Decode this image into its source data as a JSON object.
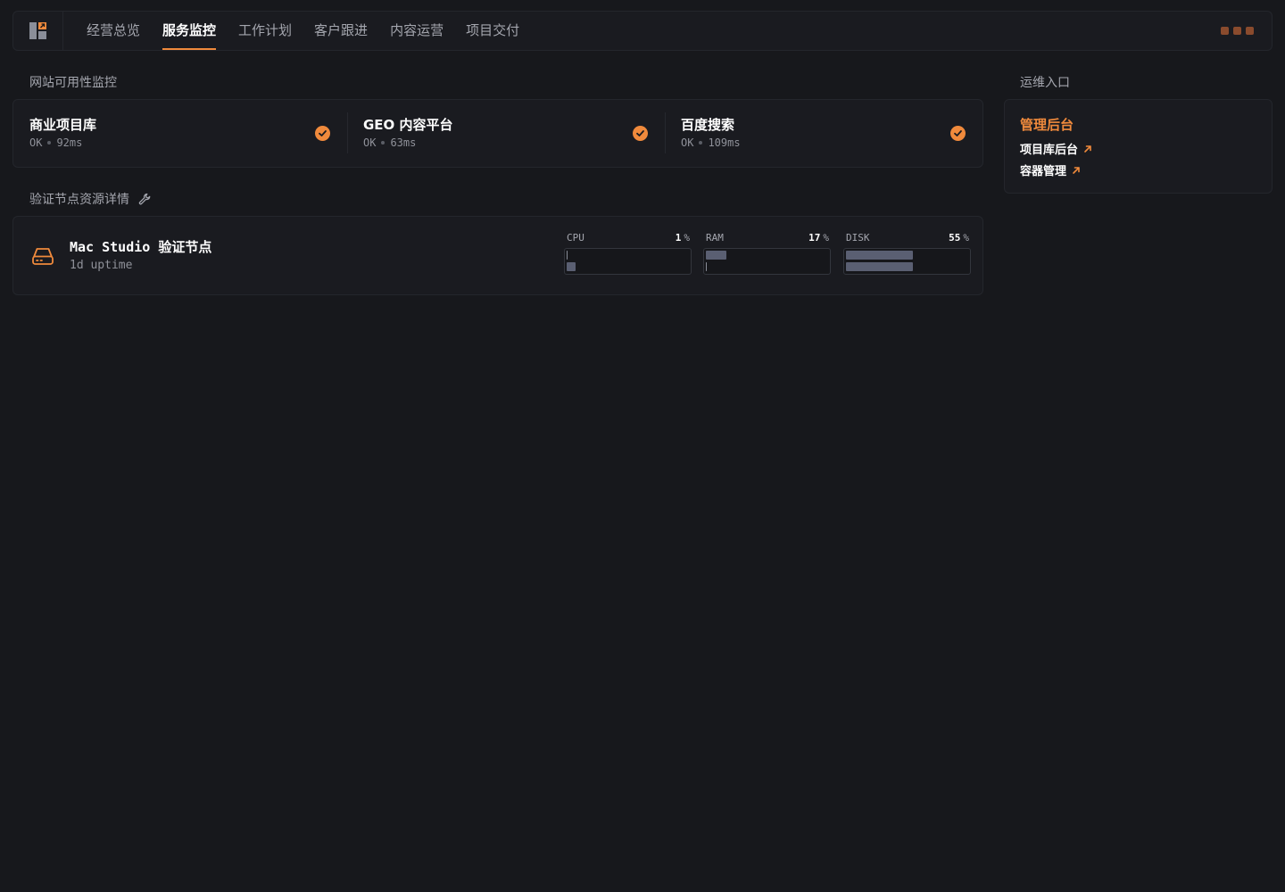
{
  "nav": {
    "tabs": [
      {
        "label": "经营总览"
      },
      {
        "label": "服务监控",
        "active": true
      },
      {
        "label": "工作计划"
      },
      {
        "label": "客户跟进"
      },
      {
        "label": "内容运营"
      },
      {
        "label": "项目交付"
      }
    ]
  },
  "monitor": {
    "title": "网站可用性监控",
    "sites": [
      {
        "name": "商业项目库",
        "status": "OK",
        "latency": "92ms"
      },
      {
        "name": "GEO 内容平台",
        "status": "OK",
        "latency": "63ms"
      },
      {
        "name": "百度搜索",
        "status": "OK",
        "latency": "109ms"
      }
    ]
  },
  "node": {
    "section_title": "验证节点资源详情",
    "name": "Mac Studio 验证节点",
    "uptime": "1d uptime",
    "metrics": [
      {
        "label": "CPU",
        "value": "1",
        "unit": "%",
        "percent": 1
      },
      {
        "label": "RAM",
        "value": "17",
        "unit": "%",
        "percent": 17
      },
      {
        "label": "DISK",
        "value": "55",
        "unit": "%",
        "percent": 55
      }
    ]
  },
  "ops": {
    "section_title": "运维入口",
    "card_title": "管理后台",
    "links": [
      {
        "label": "项目库后台"
      },
      {
        "label": "容器管理"
      }
    ]
  },
  "colors": {
    "accent": "#f08a3c",
    "background": "#17181c",
    "card": "#1a1b20",
    "bar": "#5a5f72"
  },
  "icons": {
    "logo": "app-logo-icon",
    "check": "check-circle-icon",
    "wrench": "wrench-icon",
    "drive": "hard-drive-icon",
    "external": "arrow-up-right-icon"
  }
}
